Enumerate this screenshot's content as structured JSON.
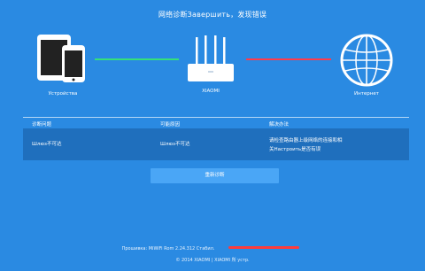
{
  "page": {
    "title": "网络诊断Завершить，发现错误"
  },
  "topology": {
    "devices_label": "Устройства",
    "router_label": "XIAOMI",
    "internet_label": "Интернет",
    "left_link_color": "#35e07a",
    "right_link_color": "#ff3b4a"
  },
  "table": {
    "headers": [
      "诊断问题",
      "可能原因",
      "解决办法"
    ],
    "rows": [
      {
        "problem": "Шлюз不可达",
        "cause": "Шлюз不可达",
        "solution_line1": "请检查路由器上级网络的连接和相",
        "solution_line2": "关Настроить是否有误"
      }
    ]
  },
  "actions": {
    "rediagnose_label": "重新诊断"
  },
  "footer": {
    "firmware": "Прошивка: MiWiFi Rom 2.24.312 Стабил.",
    "copyright": "© 2014 XIAOMI | XIAOMI 所 устр."
  }
}
